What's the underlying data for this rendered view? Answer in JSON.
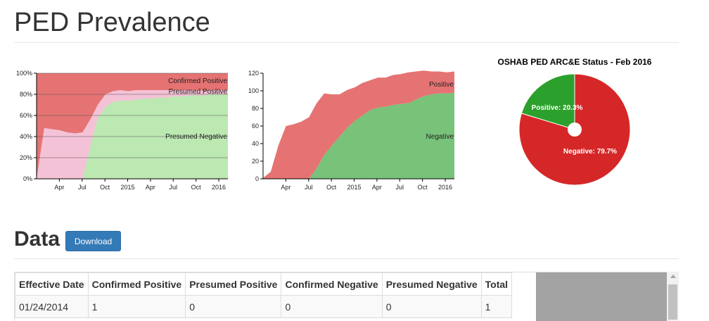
{
  "page": {
    "title": "PED Prevalence"
  },
  "data_section": {
    "title": "Data",
    "download_label": "Download"
  },
  "colors": {
    "confirmed_positive": "#e57373",
    "presumed_positive": "#f4c2d6",
    "presumed_negative": "#bce8b2",
    "positive": "#e57373",
    "negative": "#78c27a",
    "pie_positive": "#2ca02c",
    "pie_negative": "#d62728"
  },
  "chart_data": [
    {
      "type": "area",
      "stacked": "percent",
      "x": [
        "2014-01",
        "2014-02",
        "2014-03",
        "2014-04",
        "2014-05",
        "2014-06",
        "2014-07",
        "2014-08",
        "2014-09",
        "2014-10",
        "2014-11",
        "2014-12",
        "2015-01",
        "2015-02",
        "2015-03",
        "2015-04",
        "2015-05",
        "2015-06",
        "2015-07",
        "2015-08",
        "2015-09",
        "2015-10",
        "2015-11",
        "2015-12",
        "2016-01",
        "2016-02"
      ],
      "series": [
        {
          "name": "Presumed Negative",
          "values": [
            0,
            0,
            0,
            0,
            0,
            0,
            0,
            30,
            58,
            68,
            73,
            74,
            74,
            75,
            76,
            76,
            77,
            77,
            78,
            78,
            79,
            79,
            79,
            80,
            80,
            80
          ]
        },
        {
          "name": "Presumed Positive",
          "values": [
            0,
            48,
            47,
            46,
            44,
            43,
            44,
            26,
            12,
            12,
            10,
            10,
            9,
            9,
            8,
            8,
            7,
            7,
            6,
            6,
            5,
            5,
            4,
            4,
            4,
            4
          ]
        },
        {
          "name": "Confirmed Positive",
          "values": [
            100,
            52,
            53,
            54,
            56,
            57,
            56,
            44,
            30,
            20,
            17,
            16,
            17,
            16,
            16,
            16,
            16,
            16,
            16,
            16,
            16,
            16,
            17,
            16,
            16,
            16
          ]
        }
      ],
      "xticks": [
        "Apr",
        "Jul",
        "Oct",
        "2015",
        "Apr",
        "Jul",
        "Oct",
        "2016"
      ],
      "yticks": [
        "0%",
        "20%",
        "40%",
        "60%",
        "80%",
        "100%"
      ],
      "ylim": [
        0,
        100
      ],
      "grid": true
    },
    {
      "type": "area",
      "stacked": "absolute",
      "x": [
        "2014-01",
        "2014-02",
        "2014-03",
        "2014-04",
        "2014-05",
        "2014-06",
        "2014-07",
        "2014-08",
        "2014-09",
        "2014-10",
        "2014-11",
        "2014-12",
        "2015-01",
        "2015-02",
        "2015-03",
        "2015-04",
        "2015-05",
        "2015-06",
        "2015-07",
        "2015-08",
        "2015-09",
        "2015-10",
        "2015-11",
        "2015-12",
        "2016-01",
        "2016-02"
      ],
      "series": [
        {
          "name": "Negative",
          "values": [
            0,
            0,
            0,
            0,
            0,
            0,
            0,
            12,
            27,
            38,
            48,
            58,
            66,
            72,
            78,
            81,
            82,
            84,
            85,
            86,
            90,
            94,
            96,
            97,
            97,
            98
          ]
        },
        {
          "name": "Positive",
          "values": [
            1,
            8,
            38,
            60,
            62,
            65,
            70,
            74,
            70,
            58,
            48,
            43,
            38,
            37,
            34,
            34,
            33,
            34,
            34,
            35,
            32,
            29,
            26,
            25,
            24,
            24
          ]
        }
      ],
      "xticks": [
        "Apr",
        "Jul",
        "Oct",
        "2015",
        "Apr",
        "Jul",
        "Oct",
        "2016"
      ],
      "yticks": [
        "0",
        "20",
        "40",
        "60",
        "80",
        "100",
        "120"
      ],
      "ylim": [
        0,
        120
      ],
      "grid": false
    },
    {
      "type": "pie",
      "title": "OSHAB PED ARC&E Status - Feb 2016",
      "slices": [
        {
          "label": "Positive",
          "value": 20.3,
          "text": "Positive: 20.3%"
        },
        {
          "label": "Negative",
          "value": 79.7,
          "text": "Negative: 79.7%"
        }
      ]
    }
  ],
  "table": {
    "headers": [
      "Effective Date",
      "Confirmed Positive",
      "Presumed Positive",
      "Confirmed Negative",
      "Presumed Negative",
      "Total"
    ],
    "rows": [
      [
        "01/24/2014",
        "1",
        "0",
        "0",
        "0",
        "1"
      ]
    ]
  }
}
